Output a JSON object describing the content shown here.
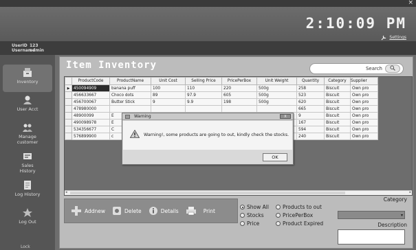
{
  "window": {
    "close_glyph": "×"
  },
  "header": {
    "clock": "2:10:09 PM",
    "settings_label": "Settings"
  },
  "user": {
    "userid_label": "UserID",
    "userid_value": "123",
    "username_label": "Username",
    "username_value": "admin"
  },
  "sidebar": {
    "items": [
      {
        "label": "Inventory",
        "icon": "inventory-icon"
      },
      {
        "label": "User Acct",
        "icon": "user-icon"
      },
      {
        "label": "Manage customer",
        "icon": "customers-icon"
      },
      {
        "label": "Sales History",
        "icon": "sales-icon"
      },
      {
        "label": "Log History",
        "icon": "log-icon"
      },
      {
        "label": "Log Out",
        "icon": "logout-icon"
      }
    ],
    "footer": "Lock"
  },
  "panel": {
    "title": "Item Inventory",
    "search_label": "Search"
  },
  "table": {
    "columns": [
      "ProductCode",
      "ProductName",
      "Unit Cost",
      "Selling Price",
      "PricePerBox",
      "Unit Weight",
      "Quantity",
      "Category",
      "Supplier"
    ],
    "rows": [
      [
        "450094909",
        "banana puff",
        "100",
        "110",
        "220",
        "500g",
        "258",
        "Biscuit",
        "Own pro"
      ],
      [
        "456633667",
        "Choco dots",
        "89",
        "97.9",
        "605",
        "500g",
        "523",
        "Biscuit",
        "Own pro"
      ],
      [
        "456700067",
        "Butter Stick",
        "9",
        "9.9",
        "198",
        "500g",
        "620",
        "Biscuit",
        "Own pro"
      ],
      [
        "478980000",
        "",
        "",
        "",
        "",
        "",
        "665",
        "Biscuit",
        "Own pro"
      ],
      [
        "48900099",
        "E",
        "",
        "",
        "",
        "",
        "9",
        "Biscuit",
        "Own pro"
      ],
      [
        "490098978",
        "E",
        "",
        "",
        "",
        "",
        "167",
        "Biscuit",
        "Own pro"
      ],
      [
        "534356677",
        "C",
        "",
        "",
        "",
        "",
        "594",
        "Biscuit",
        "Own pro"
      ],
      [
        "576899900",
        "c",
        "",
        "",
        "",
        "",
        "240",
        "Biscuit",
        "Own pro"
      ]
    ],
    "selected_row_marker": "▶"
  },
  "actions": {
    "add": "Addnew",
    "delete": "Delete",
    "details": "Details",
    "print": "Print"
  },
  "filters": {
    "show_all": "Show All",
    "stocks": "Stocks",
    "price": "Price",
    "products_to_out": "Products to out",
    "price_per_box": "PricePerBox",
    "product_expired": "Product Expired",
    "selected": "show_all"
  },
  "category": {
    "label": "Category",
    "value": ""
  },
  "description": {
    "label": "Description",
    "value": ""
  },
  "dialog": {
    "title": "Warning",
    "message": "Warning!, some products are going to out, kindly check the stocks.",
    "ok": "OK",
    "close_glyph": "X"
  }
}
